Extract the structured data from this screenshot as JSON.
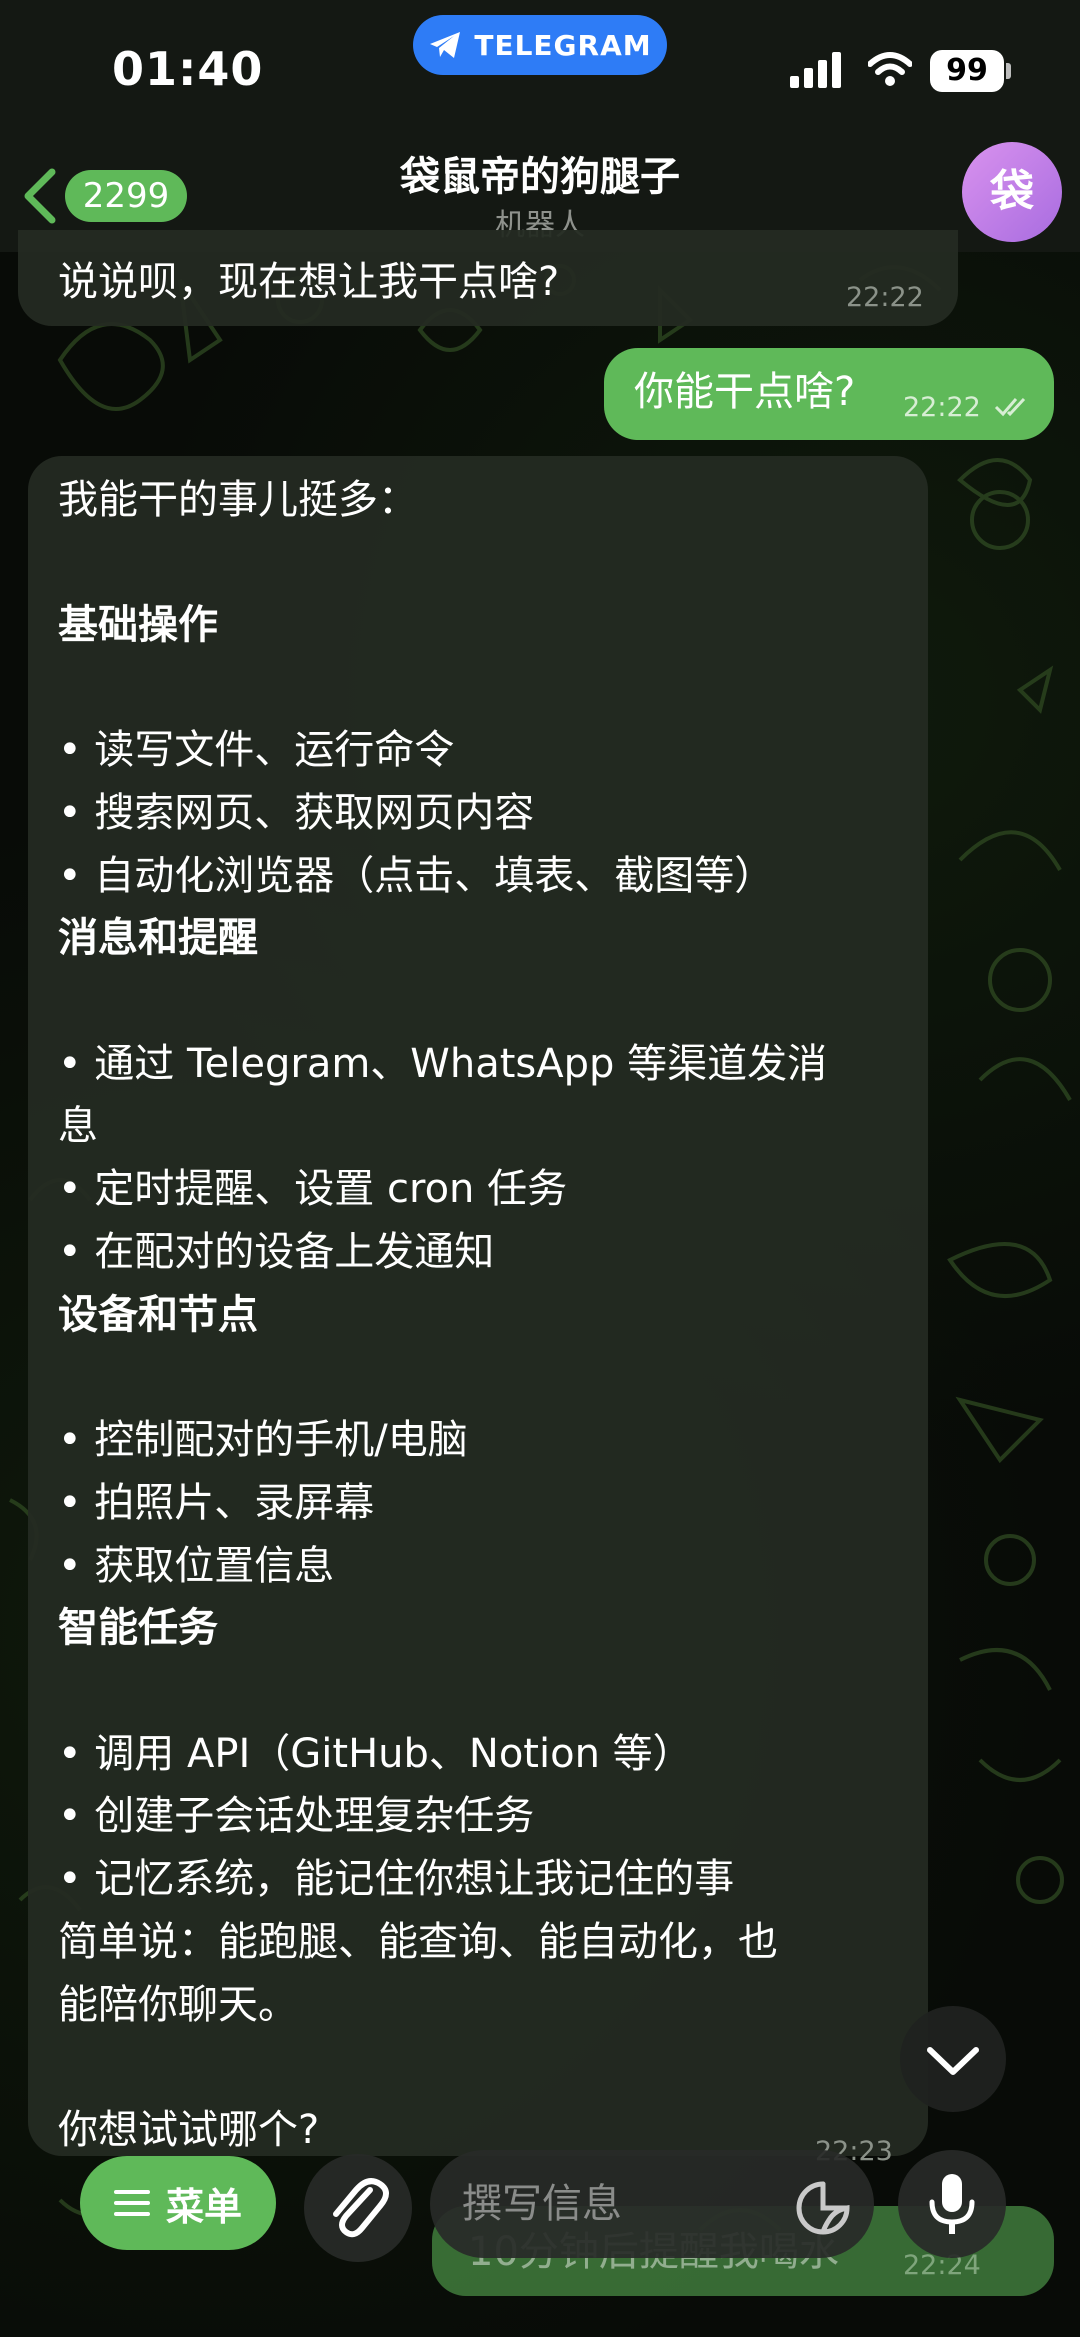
{
  "status_bar": {
    "time": "01:40",
    "app_pill": "TELEGRAM",
    "battery": "99"
  },
  "header": {
    "back_count": "2299",
    "title": "袋鼠帝的狗腿子",
    "subtitle": "机器人",
    "avatar_letter": "袋"
  },
  "messages": {
    "prev_in": {
      "text": "说说呗，现在想让我干点啥?",
      "time": "22:22"
    },
    "out": {
      "text": "你能干点啥?",
      "time": "22:22"
    },
    "reply": {
      "lines": [
        "我能干的事儿挺多：",
        "基础操作",
        "• 读写文件、运行命令",
        "• 搜索网页、获取网页内容",
        "• 自动化浏览器（点击、填表、截图等）",
        "消息和提醒",
        "• 通过 Telegram、WhatsApp 等渠道发消",
        "息",
        "• 定时提醒、设置 cron 任务",
        "• 在配对的设备上发通知",
        "设备和节点",
        "• 控制配对的手机/电脑",
        "• 拍照片、录屏幕",
        "• 获取位置信息",
        "智能任务",
        "• 调用 API（GitHub、Notion 等）",
        "• 创建子会话处理复杂任务",
        "• 记忆系统，能记住你想让我记住的事",
        "简单说：能跑腿、能查询、能自动化，也",
        "能陪你聊天。",
        "你想试试哪个?"
      ],
      "time": "22:23"
    },
    "partial_out": {
      "text": "10分钟后提醒我喝水",
      "time": "22:24"
    }
  },
  "input_bar": {
    "menu_label": "菜单",
    "placeholder": "撰写信息"
  },
  "icons": {
    "back": "chevron-left-icon",
    "attach": "paperclip-icon",
    "sticker": "sticker-icon",
    "mic": "microphone-icon",
    "scroll": "chevron-down-icon",
    "menu": "hamburger-icon",
    "telegram": "paper-plane-icon"
  },
  "colors": {
    "accent": "#5fb959",
    "telegram_pill": "#2e7cf6",
    "avatar": "#c582ea"
  }
}
